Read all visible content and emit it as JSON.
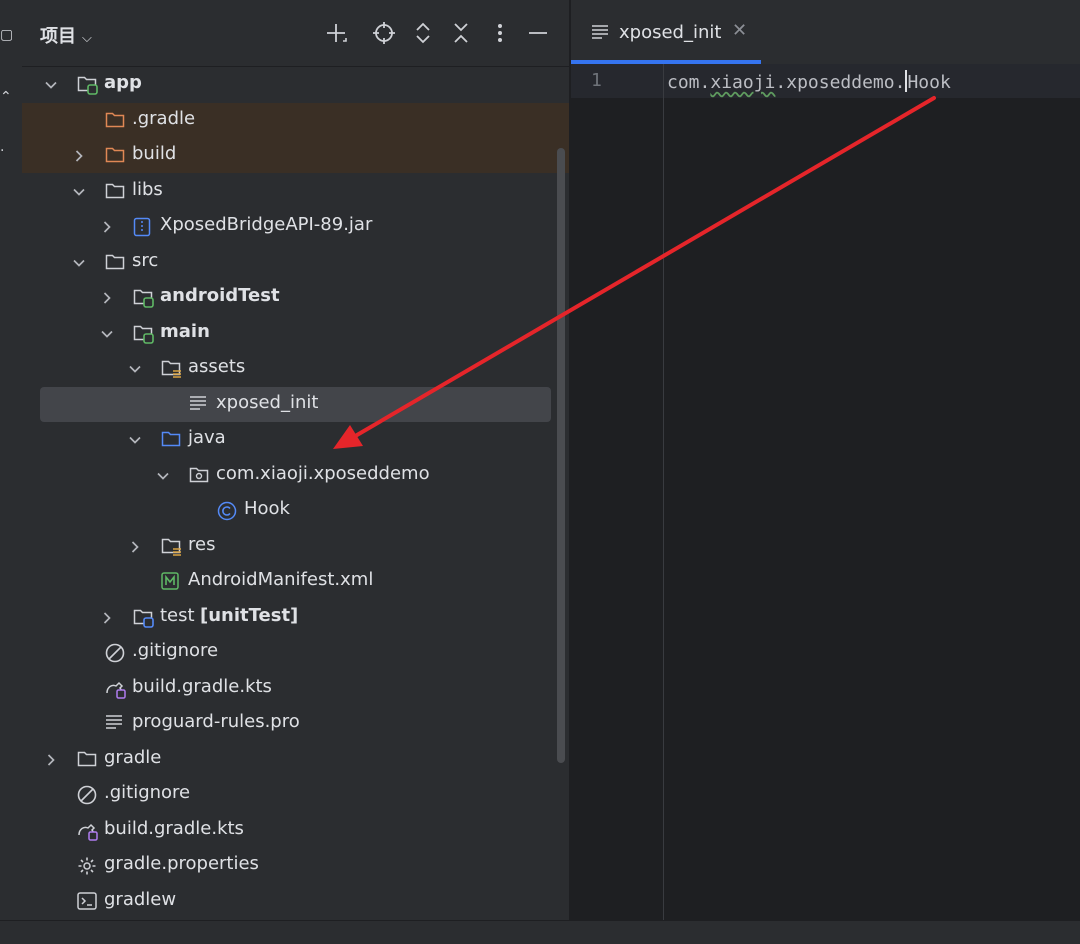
{
  "project_panel": {
    "title": "项目",
    "tree": [
      {
        "label": "app",
        "bold": true,
        "icon": "module-folder-icon",
        "arrow": "down"
      },
      {
        "label": ".gradle",
        "icon": "excluded-folder-icon",
        "highlight": true
      },
      {
        "label": "build",
        "icon": "excluded-folder-icon",
        "arrow": "right",
        "highlight": true
      },
      {
        "label": "libs",
        "icon": "folder-icon",
        "arrow": "down"
      },
      {
        "label": "XposedBridgeAPI-89.jar",
        "icon": "jar-icon",
        "arrow": "right"
      },
      {
        "label": "src",
        "icon": "folder-icon",
        "arrow": "down"
      },
      {
        "label": "androidTest",
        "bold": true,
        "icon": "module-folder-icon",
        "arrow": "right"
      },
      {
        "label": "main",
        "bold": true,
        "icon": "module-folder-icon",
        "arrow": "down"
      },
      {
        "label": "assets",
        "icon": "resource-folder-icon",
        "arrow": "down"
      },
      {
        "label": "xposed_init",
        "icon": "text-file-icon",
        "selected": true
      },
      {
        "label": "java",
        "icon": "source-folder-icon",
        "arrow": "down"
      },
      {
        "label": "com.xiaoji.xposeddemo",
        "icon": "package-icon",
        "arrow": "down"
      },
      {
        "label": "Hook",
        "icon": "class-icon"
      },
      {
        "label": "res",
        "icon": "resource-folder-icon",
        "arrow": "right"
      },
      {
        "label": "AndroidManifest.xml",
        "icon": "manifest-icon"
      },
      {
        "label": "test",
        "suffix": "[unitTest]",
        "icon": "test-folder-icon",
        "arrow": "right"
      },
      {
        "label": ".gitignore",
        "icon": "ignore-file-icon"
      },
      {
        "label": "build.gradle.kts",
        "icon": "gradle-file-icon"
      },
      {
        "label": "proguard-rules.pro",
        "icon": "text-file-icon"
      },
      {
        "label": "gradle",
        "icon": "folder-icon",
        "arrow": "right"
      },
      {
        "label": ".gitignore",
        "icon": "ignore-file-icon"
      },
      {
        "label": "build.gradle.kts",
        "icon": "gradle-file-icon"
      },
      {
        "label": "gradle.properties",
        "icon": "settings-gear-icon"
      },
      {
        "label": "gradlew",
        "icon": "terminal-file-icon"
      }
    ]
  },
  "editor": {
    "tab_label": "xposed_init",
    "line_number": "1",
    "code_prefix": "com.",
    "code_wavy": "xiaoji",
    "code_middle": ".xposeddemo.",
    "code_suffix": "Hook"
  },
  "colors": {
    "accent": "#3574f0",
    "annotation_arrow": "#e5252a",
    "panel_bg": "#2b2d30",
    "editor_bg": "#1e1f22"
  }
}
